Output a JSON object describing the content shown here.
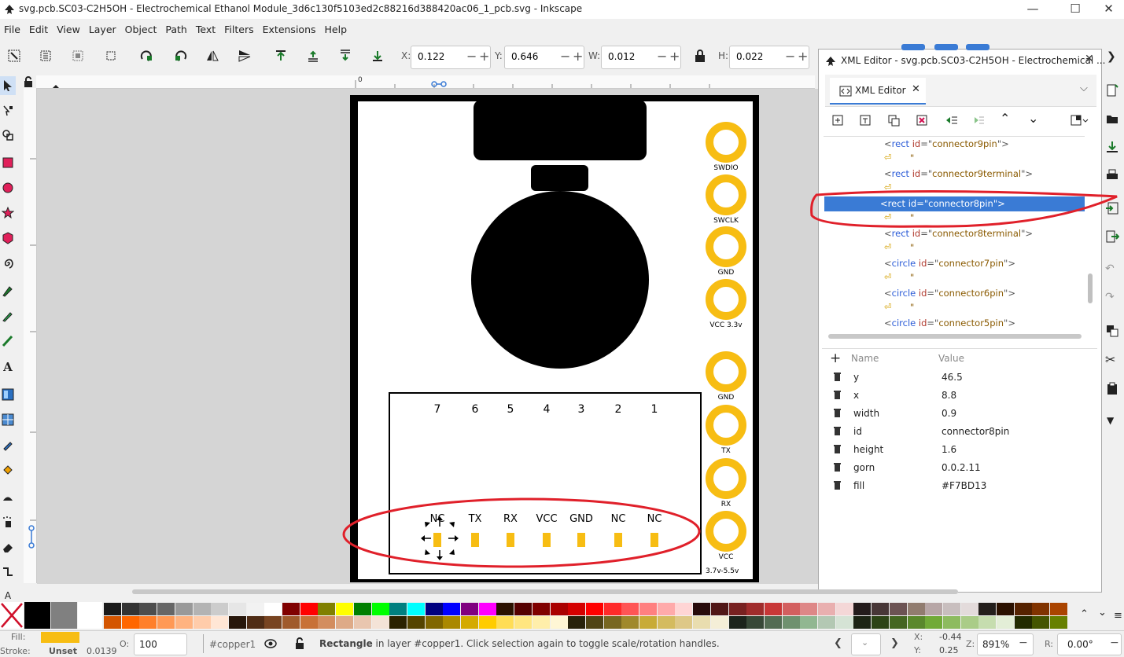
{
  "window": {
    "title": "svg.pcb.SC03-C2H5OH - Electrochemical Ethanol Module_3d6c130f5103ed2c88216d388420ac06_1_pcb.svg - Inkscape",
    "minimize": "—",
    "maximize": "☐",
    "close": "✕"
  },
  "menu": [
    "File",
    "Edit",
    "View",
    "Layer",
    "Object",
    "Path",
    "Text",
    "Filters",
    "Extensions",
    "Help"
  ],
  "toolbar": {
    "x_label": "X:",
    "x_value": "0.122",
    "y_label": "Y:",
    "y_value": "0.646",
    "w_label": "W:",
    "w_value": "0.012",
    "h_label": "H:",
    "h_value": "0.022"
  },
  "ruler": {
    "zero": "0"
  },
  "canvas": {
    "pads_right": [
      {
        "label": "SWDIO"
      },
      {
        "label": "SWCLK"
      },
      {
        "label": "GND"
      },
      {
        "label": "VCC 3.3v"
      },
      {
        "label": "GND"
      },
      {
        "label": "TX"
      },
      {
        "label": "RX"
      },
      {
        "label": "VCC"
      }
    ],
    "footnote": "3.7v-5.5v",
    "pin_numbers": [
      "7",
      "6",
      "5",
      "4",
      "3",
      "2",
      "1"
    ],
    "pin_labels": [
      "NC",
      "TX",
      "RX",
      "VCC",
      "GND",
      "NC",
      "NC"
    ],
    "pad_color": "#F7BD13"
  },
  "xml_editor": {
    "window_title": "XML Editor - svg.pcb.SC03-C2H5OH - Electrochemical ...",
    "tab_label": "XML Editor",
    "nodes": [
      {
        "type": "element",
        "tag": "rect",
        "attr": "id",
        "value": "connector9pin"
      },
      {
        "type": "text",
        "text": "\""
      },
      {
        "type": "element",
        "tag": "rect",
        "attr": "id",
        "value": "connector9terminal"
      },
      {
        "type": "text",
        "text": ""
      },
      {
        "type": "element",
        "tag": "rect",
        "attr": "id",
        "value": "connector8pin",
        "selected": true
      },
      {
        "type": "text",
        "text": "\""
      },
      {
        "type": "element",
        "tag": "rect",
        "attr": "id",
        "value": "connector8terminal"
      },
      {
        "type": "text",
        "text": "\""
      },
      {
        "type": "element",
        "tag": "circle",
        "attr": "id",
        "value": "connector7pin"
      },
      {
        "type": "text",
        "text": "\""
      },
      {
        "type": "element",
        "tag": "circle",
        "attr": "id",
        "value": "connector6pin"
      },
      {
        "type": "text",
        "text": "\""
      },
      {
        "type": "element",
        "tag": "circle",
        "attr": "id",
        "value": "connector5pin"
      }
    ],
    "attr_header_name": "Name",
    "attr_header_value": "Value",
    "attributes": [
      {
        "name": "y",
        "value": "46.5"
      },
      {
        "name": "x",
        "value": "8.8"
      },
      {
        "name": "width",
        "value": "0.9"
      },
      {
        "name": "id",
        "value": "connector8pin"
      },
      {
        "name": "height",
        "value": "1.6"
      },
      {
        "name": "gorn",
        "value": "0.0.2.11"
      },
      {
        "name": "fill",
        "value": "#F7BD13"
      }
    ]
  },
  "status": {
    "fill_label": "Fill:",
    "stroke_label": "Stroke:",
    "stroke_value": "Unset",
    "stroke_width": "0.0139",
    "opacity_label": "O:",
    "opacity_value": "100",
    "layer": "#copper1",
    "message_bold": "Rectangle",
    "message_rest": " in layer #copper1. Click selection again to toggle scale/rotation handles.",
    "cursor_x_label": "X:",
    "cursor_x": "-0.44",
    "cursor_y_label": "Y:",
    "cursor_y": "0.25",
    "zoom_label": "Z:",
    "zoom": "891%",
    "rotate_label": "R:",
    "rotate": "0.00°"
  },
  "colors": {
    "accent": "#F7BD13",
    "selection": "#3a7bd5",
    "annotation": "#e0202a"
  }
}
